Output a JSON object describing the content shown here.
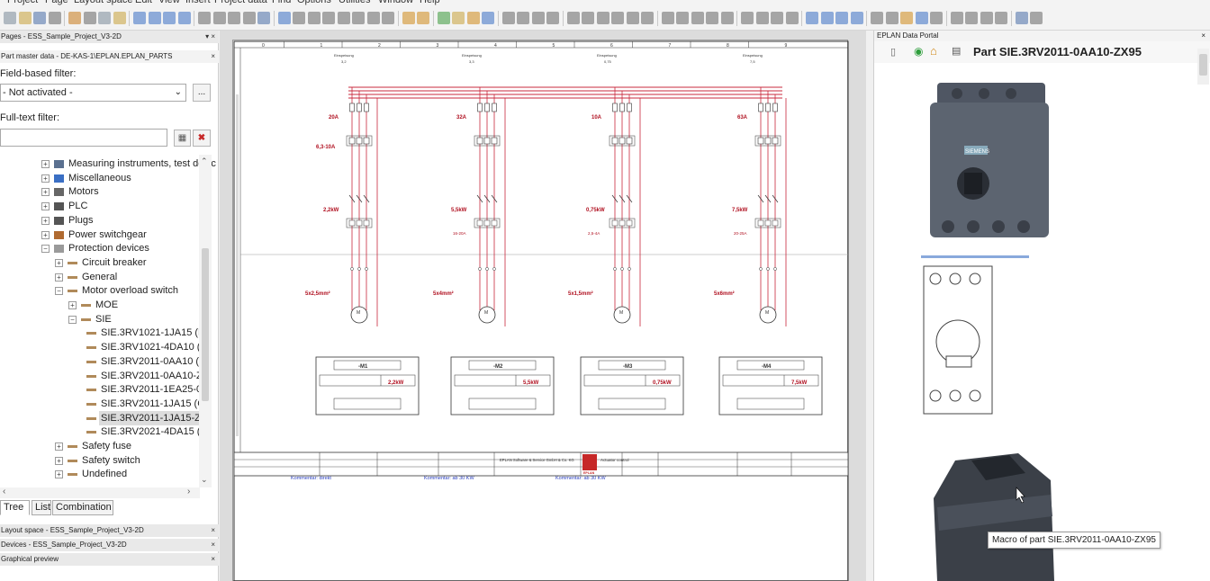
{
  "menubar": [
    "Project",
    "Page",
    "Layout space",
    "Edit",
    "View",
    "Insert",
    "Project data",
    "Find",
    "Options",
    "Utilities",
    "Window",
    "Help"
  ],
  "left_panel": {
    "pages_header": "Pages - ESS_Sample_Project_V3-2D",
    "parts_header": "Part master data - DE-KAS-1\\EPLAN.EPLAN_PARTS",
    "field_filter_label": "Field-based filter:",
    "field_filter_value": "- Not activated -",
    "field_filter_more": "...",
    "fulltext_label": "Full-text filter:",
    "fulltext_value": "",
    "tree_items": [
      {
        "label": "Measuring instruments, test devices",
        "expander": "+",
        "indent": 0,
        "icon": "measuring-icon"
      },
      {
        "label": "Miscellaneous",
        "expander": "+",
        "indent": 0,
        "icon": "miscellaneous-icon"
      },
      {
        "label": "Motors",
        "expander": "+",
        "indent": 0,
        "icon": "motor-icon"
      },
      {
        "label": "PLC",
        "expander": "+",
        "indent": 0,
        "icon": "plc-icon"
      },
      {
        "label": "Plugs",
        "expander": "+",
        "indent": 0,
        "icon": "plug-icon"
      },
      {
        "label": "Power switchgear",
        "expander": "+",
        "indent": 0,
        "icon": "power-switchgear-icon"
      },
      {
        "label": "Protection devices",
        "expander": "−",
        "indent": 0,
        "icon": "protection-icon"
      },
      {
        "label": "Circuit breaker",
        "expander": "+",
        "indent": 1,
        "icon": "group-icon"
      },
      {
        "label": "General",
        "expander": "+",
        "indent": 1,
        "icon": "group-icon"
      },
      {
        "label": "Motor overload switch",
        "expander": "−",
        "indent": 1,
        "icon": "group-icon"
      },
      {
        "label": "MOE",
        "expander": "+",
        "indent": 2,
        "icon": "group-icon"
      },
      {
        "label": "SIE",
        "expander": "−",
        "indent": 2,
        "icon": "group-icon"
      },
      {
        "label": "SIE.3RV1021-1JA15 (M",
        "expander": "",
        "indent": 3,
        "icon": "part-icon"
      },
      {
        "label": "SIE.3RV1021-4DA10 (M",
        "expander": "",
        "indent": 3,
        "icon": "part-icon"
      },
      {
        "label": "SIE.3RV2011-0AA10 (C",
        "expander": "",
        "indent": 3,
        "icon": "part-icon"
      },
      {
        "label": "SIE.3RV2011-0AA10-Z",
        "expander": "",
        "indent": 3,
        "icon": "part-icon"
      },
      {
        "label": "SIE.3RV2011-1EA25-0",
        "expander": "",
        "indent": 3,
        "icon": "part-icon"
      },
      {
        "label": "SIE.3RV2011-1JA15 (C",
        "expander": "",
        "indent": 3,
        "icon": "part-icon"
      },
      {
        "label": "SIE.3RV2011-1JA15-Z\\",
        "expander": "",
        "indent": 3,
        "icon": "part-icon",
        "selected": true
      },
      {
        "label": "SIE.3RV2021-4DA15 (C",
        "expander": "",
        "indent": 3,
        "icon": "part-icon"
      },
      {
        "label": "Safety fuse",
        "expander": "+",
        "indent": 1,
        "icon": "group-icon"
      },
      {
        "label": "Safety switch",
        "expander": "+",
        "indent": 1,
        "icon": "group-icon"
      },
      {
        "label": "Undefined",
        "expander": "+",
        "indent": 1,
        "icon": "group-icon"
      }
    ],
    "tabs": [
      "Tree",
      "List",
      "Combination"
    ],
    "bottom_panels": [
      "Layout space - ESS_Sample_Project_V3-2D",
      "Devices - ESS_Sample_Project_V3-2D",
      "Graphical preview"
    ]
  },
  "schematic": {
    "columns": [
      "0",
      "1",
      "2",
      "3",
      "4",
      "5",
      "6",
      "7",
      "8",
      "9"
    ],
    "circuits": [
      {
        "group_label": "Einspeisung",
        "group_sub": "3,2",
        "fuse": "20A",
        "overload": "6,3-10A",
        "contactor": "2,2kW",
        "breaker": "",
        "motor": "-M1",
        "cable": "5x2,5mm²",
        "power": "2,2kW",
        "note": "Kommentar: direkt"
      },
      {
        "group_label": "Einspeisung",
        "group_sub": "3,3",
        "fuse": "32A",
        "overload": "",
        "contactor": "5,5kW",
        "breaker": "16-20A",
        "motor": "-M2",
        "cable": "5x4mm²",
        "power": "5,5kW",
        "note": "Kommentar: ab 30 KW"
      },
      {
        "group_label": "Einspeisung",
        "group_sub": "0,75",
        "fuse": "10A",
        "overload": "",
        "contactor": "0,75kW",
        "breaker": "2,5-4A",
        "motor": "-M3",
        "cable": "5x1,5mm²",
        "power": "0,75kW",
        "note": "Kommentar: ab 30 KW"
      },
      {
        "group_label": "Einspeisung",
        "group_sub": "7,5",
        "fuse": "63A",
        "overload": "",
        "contactor": "7,5kW",
        "breaker": "20-25A",
        "motor": "-M4",
        "cable": "5x6mm²",
        "power": "7,5kW",
        "note": ""
      }
    ],
    "titleblock": {
      "company": "EPLAN Software & Service GmbH & Co. KG",
      "title": "Actuator control",
      "logo": "EPLAN"
    },
    "colors": {
      "wire": "#c8283c",
      "text_red": "#b01020",
      "ink": "#333333",
      "note_blue": "#2a3fbf"
    }
  },
  "right_panel": {
    "header": "EPLAN Data Portal",
    "part_title": "Part SIE.3RV2011-0AA10-ZX95",
    "device_brand": "SIEMENS",
    "tooltip": "Macro of part SIE.3RV2011-0AA10-ZX95"
  }
}
